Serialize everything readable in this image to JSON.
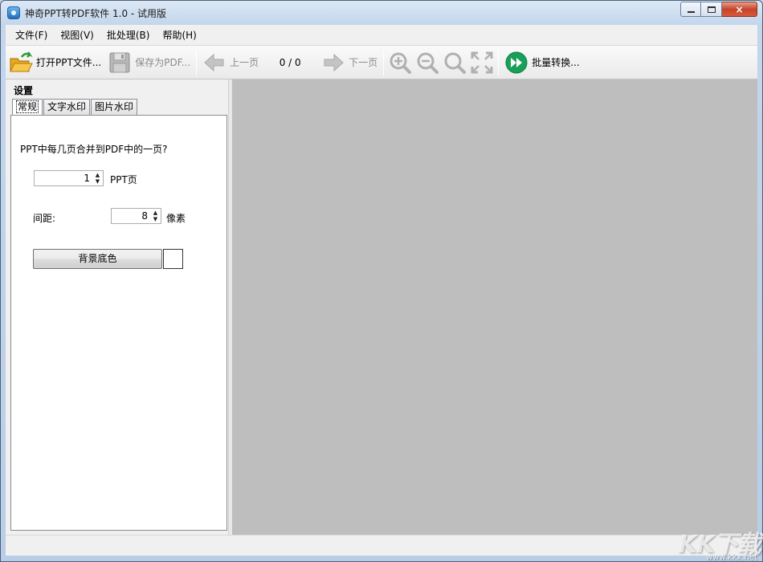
{
  "window": {
    "title": "神奇PPT转PDF软件 1.0 - 试用版",
    "close_glyph": "×"
  },
  "menu": {
    "items": [
      "文件(F)",
      "视图(V)",
      "批处理(B)",
      "帮助(H)"
    ]
  },
  "toolbar": {
    "open_label": "打开PPT文件...",
    "save_label": "保存为PDF...",
    "prev_label": "上一页",
    "page_count": "0 / 0",
    "next_label": "下一页",
    "batch_label": "批量转换..."
  },
  "settings": {
    "title": "设置",
    "tabs": [
      "常规",
      "文字水印",
      "图片水印"
    ],
    "question": "PPT中每几页合并到PDF中的一页?",
    "pages_value": "1",
    "pages_unit": "PPT页",
    "spacing_label": "间距:",
    "spacing_value": "8",
    "spacing_unit": "像素",
    "bg_button": "背景底色"
  },
  "watermark": {
    "logo": "KK下载",
    "url": "www.kkx.net"
  },
  "colors": {
    "preview_bg": "#bebebe",
    "panel_bg": "#f0f0f0",
    "batch_icon": "#18a058",
    "open_icon": "#f2b22e"
  },
  "icons": [
    "app-icon",
    "folder-open-icon",
    "save-icon",
    "arrow-left-icon",
    "arrow-right-icon",
    "zoom-in-icon",
    "zoom-out-icon",
    "zoom-reset-icon",
    "fit-screen-icon",
    "fast-forward-icon"
  ]
}
